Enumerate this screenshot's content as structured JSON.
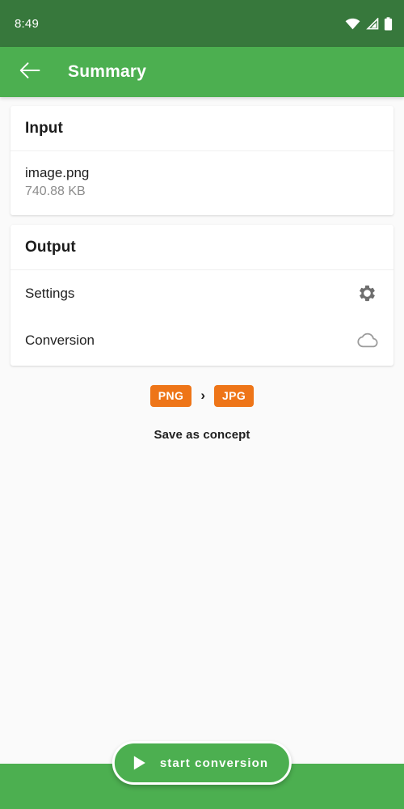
{
  "status_bar": {
    "time": "8:49",
    "icons": [
      "wifi-icon",
      "cellular-signal-icon",
      "battery-icon"
    ],
    "background_color": "#37783c"
  },
  "app_bar": {
    "title": "Summary",
    "back_icon": "arrow-left-icon",
    "background_color": "#4caf50"
  },
  "input_card": {
    "header": "Input",
    "file_name": "image.png",
    "file_size": "740.88 KB"
  },
  "output_card": {
    "header": "Output",
    "rows": [
      {
        "label": "Settings",
        "icon": "gear-icon"
      },
      {
        "label": "Conversion",
        "icon": "cloud-icon"
      }
    ]
  },
  "format_strip": {
    "source_format": "PNG",
    "arrow": "›",
    "target_format": "JPG",
    "chip_color": "#ee7518"
  },
  "save_concept": {
    "label": "Save as concept"
  },
  "bottom": {
    "start_button_label": "start conversion",
    "play_icon": "play-icon",
    "bar_color": "#4caf50"
  }
}
